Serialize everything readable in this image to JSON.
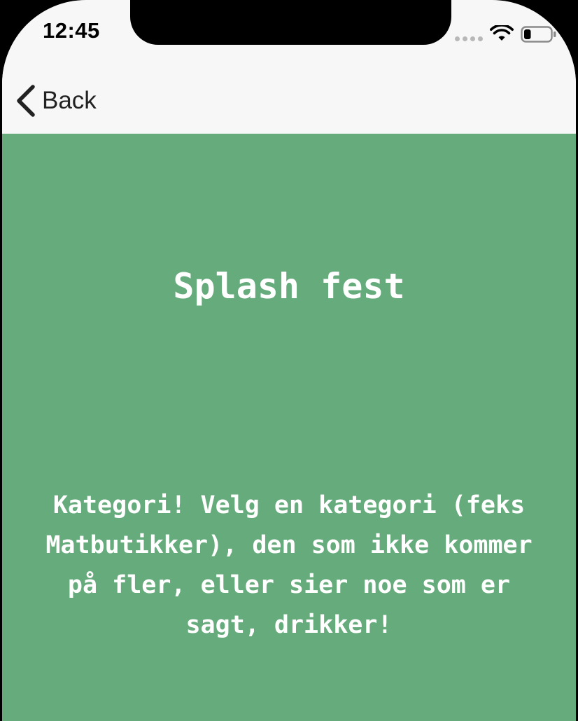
{
  "status_bar": {
    "time": "12:45",
    "signal_icon": "cellular-signal-icon",
    "wifi_icon": "wifi-icon",
    "battery_icon": "battery-icon",
    "battery_level": 0.25
  },
  "nav": {
    "back_icon": "chevron-left-icon",
    "back_label": "Back"
  },
  "card": {
    "background_color": "#66ab7c",
    "title": "Splash fest",
    "text": "Kategori! Velg en kategori (feks Matbutikker), den som ikke kommer på fler, eller sier noe som er sagt, drikker!"
  }
}
